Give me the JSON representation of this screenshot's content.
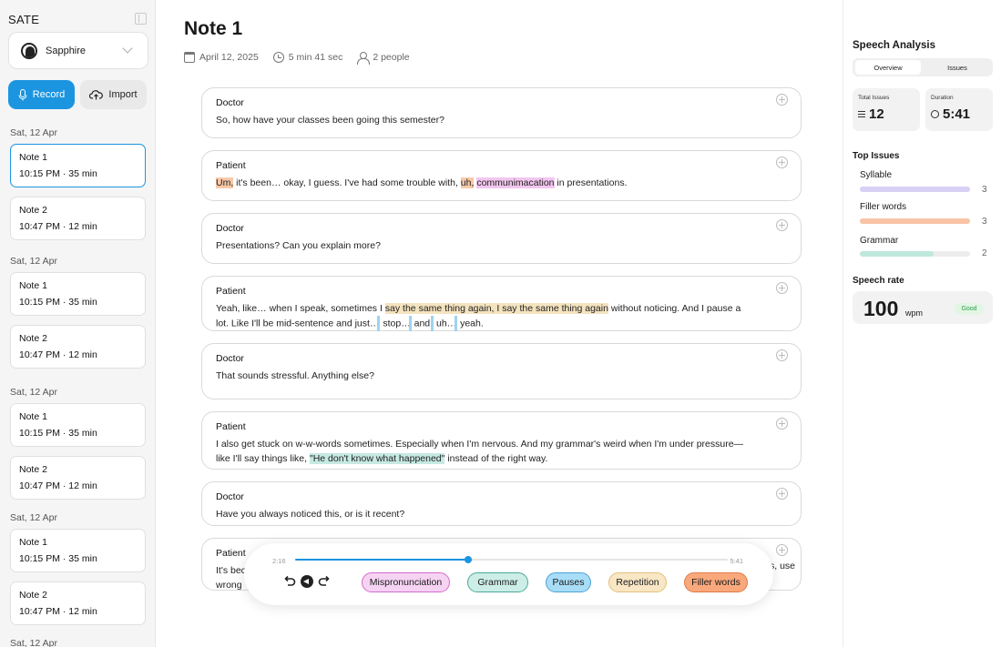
{
  "sidebar": {
    "app_title": "SATE",
    "user": "Sapphire",
    "record_label": "Record",
    "import_label": "Import",
    "groups": [
      {
        "date": "Sat, 12 Apr",
        "notes": [
          {
            "title": "Note 1",
            "meta": "10:15 PM · 35 min"
          },
          {
            "title": "Note 2",
            "meta": "10:47 PM · 12 min"
          }
        ]
      },
      {
        "date": "Sat, 12 Apr",
        "notes": [
          {
            "title": "Note 1",
            "meta": "10:15 PM · 35 min"
          },
          {
            "title": "Note 2",
            "meta": "10:47 PM · 12 min"
          }
        ]
      },
      {
        "date": "Sat, 12 Apr",
        "notes": [
          {
            "title": "Note 1",
            "meta": "10:15 PM · 35 min"
          },
          {
            "title": "Note 2",
            "meta": "10:47 PM · 12 min"
          }
        ]
      },
      {
        "date": "Sat, 12 Apr",
        "notes": [
          {
            "title": "Note 1",
            "meta": "10:15 PM · 35 min"
          },
          {
            "title": "Note 2",
            "meta": "10:47 PM · 12 min"
          }
        ]
      },
      {
        "date": "Sat, 12 Apr"
      }
    ]
  },
  "note": {
    "title": "Note 1",
    "date": "April 12, 2025",
    "duration": "5 min 41 sec",
    "people": "2 people"
  },
  "transcript": [
    {
      "speaker": "Doctor",
      "parts": [
        {
          "t": "So, how have your classes been going this semester?"
        }
      ]
    },
    {
      "speaker": "Patient",
      "parts": [
        {
          "t": "Um,",
          "h": "filler"
        },
        {
          "t": " it's been… okay, I guess. I've had some trouble with, "
        },
        {
          "t": "uh,",
          "h": "filler"
        },
        {
          "t": " "
        },
        {
          "t": "communimacation",
          "h": "mispron"
        },
        {
          "t": " in presentations."
        }
      ]
    },
    {
      "speaker": "Doctor",
      "parts": [
        {
          "t": "Presentations? Can you explain more?"
        }
      ]
    },
    {
      "speaker": "Patient",
      "parts": [
        {
          "t": "Yeah, like… when I speak, sometimes I "
        },
        {
          "t": "say the same thing again, I say the same thing again",
          "h": "rep"
        },
        {
          "t": " without noticing. And I pause a lot. Like I'll be mid-sentence and just…"
        },
        {
          "p": 1
        },
        {
          "t": " stop…"
        },
        {
          "p": 1
        },
        {
          "t": " and,"
        },
        {
          "p": 1
        },
        {
          "t": " uh…"
        },
        {
          "p": 1
        },
        {
          "t": " yeah."
        }
      ]
    },
    {
      "speaker": "Doctor",
      "parts": [
        {
          "t": "That sounds stressful. Anything else?"
        }
      ]
    },
    {
      "speaker": "Patient",
      "parts": [
        {
          "t": "I also get stuck on w-w-words sometimes. Especially when I'm nervous. And my grammar's weird when I'm under pressure—like I'll say things like, "
        },
        {
          "t": "\"He don't know what happened\"",
          "h": "gram"
        },
        {
          "t": " instead of the right way."
        }
      ]
    },
    {
      "speaker": "Doctor",
      "parts": [
        {
          "t": "Have you always noticed this, or is it recent?"
        }
      ]
    },
    {
      "speaker": "Patient",
      "parts": [
        {
          "t": "It's bec"
        },
        {
          "t": "s, use"
        },
        {
          "t": "wrong"
        }
      ]
    }
  ],
  "player": {
    "current": "2:16",
    "total": "5:41",
    "progress": 0.4,
    "chips": [
      {
        "label": "Mispronunciation",
        "bg": "#f6d3f3",
        "border": "#d56bcc"
      },
      {
        "label": "Grammar",
        "bg": "#cdeee7",
        "border": "#4aa99a"
      },
      {
        "label": "Pauses",
        "bg": "#a8dcf7",
        "border": "#4aa3d6"
      },
      {
        "label": "Repetition",
        "bg": "#f8e6c4",
        "border": "#e2c17a"
      },
      {
        "label": "Filler words",
        "bg": "#f9a87c",
        "border": "#e07a45"
      }
    ]
  },
  "analysis": {
    "title": "Speech Analysis",
    "tabs": [
      "Overview",
      "Issues"
    ],
    "total_issues_label": "Total Issues",
    "total_issues": "12",
    "duration_label": "Duration",
    "duration": "5:41",
    "top_issues_title": "Top Issues",
    "issues": [
      {
        "name": "Syllable",
        "count": "3",
        "fill": 1.0,
        "color": "#d8d0f5"
      },
      {
        "name": "Filler words",
        "count": "3",
        "fill": 1.0,
        "color": "#f9c3a6"
      },
      {
        "name": "Grammar",
        "count": "2",
        "fill": 0.67,
        "color": "#bfe8dc"
      }
    ],
    "rate_title": "Speech rate",
    "rate": "100",
    "rate_unit": "wpm",
    "rate_badge": "Good"
  }
}
